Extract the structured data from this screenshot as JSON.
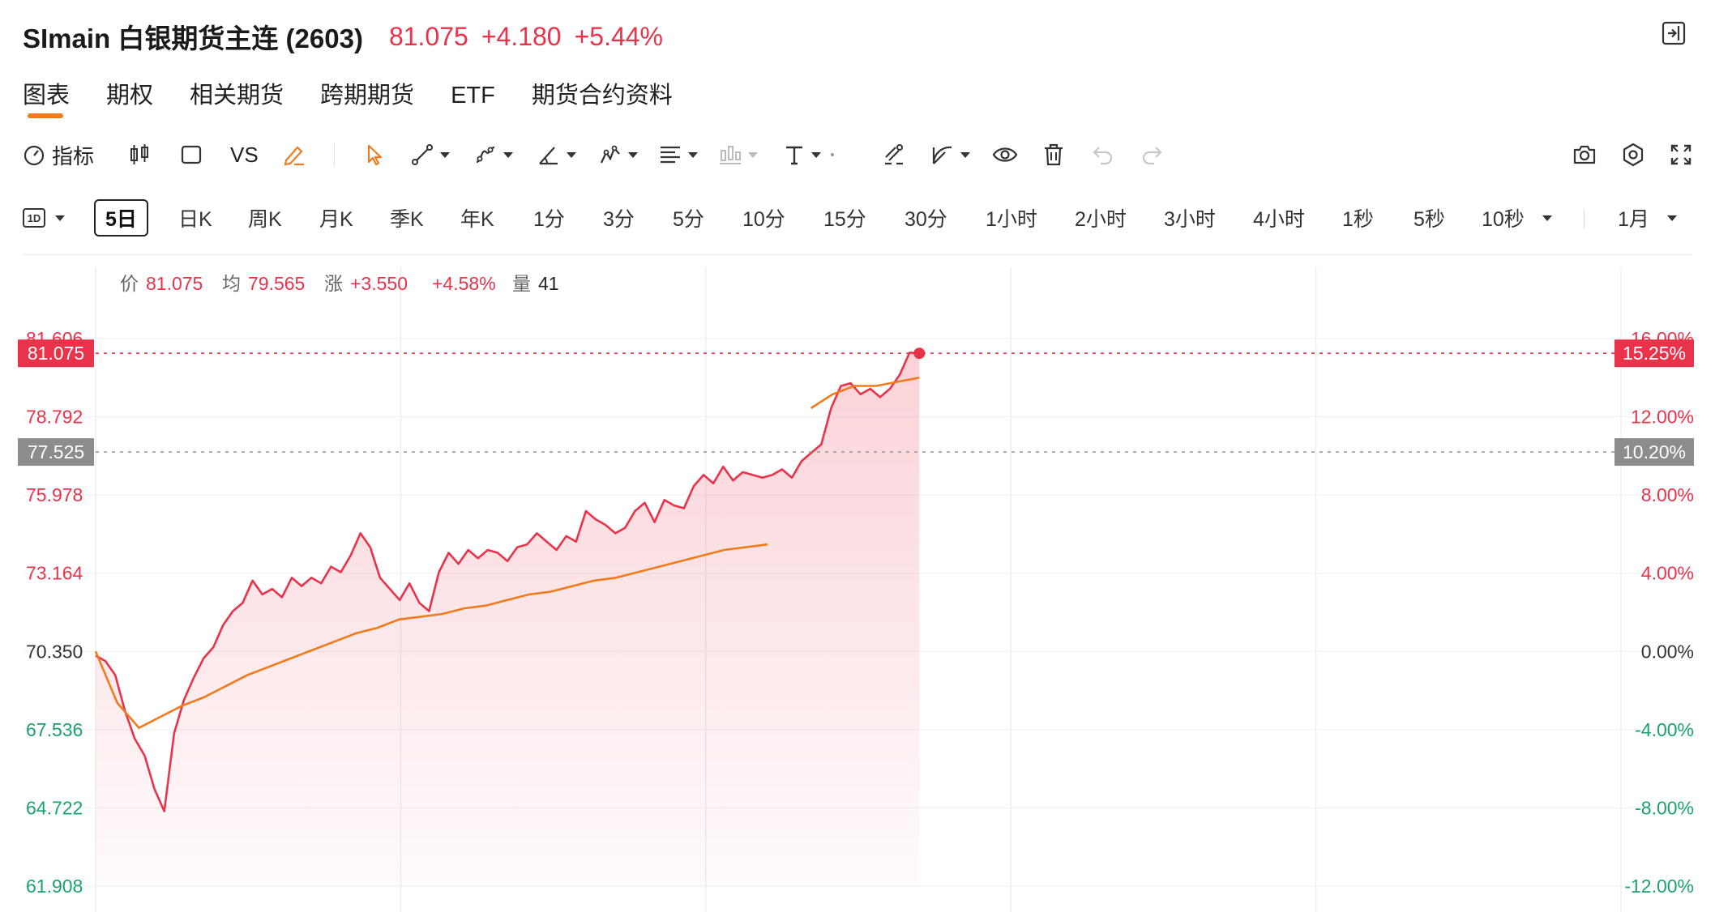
{
  "header": {
    "title": "SImain 白银期货主连 (2603)",
    "price": "81.075",
    "change": "+4.180",
    "change_pct": "+5.44%",
    "exit_icon": "exit-panel-icon"
  },
  "tabs": [
    "图表",
    "期权",
    "相关期货",
    "跨期期货",
    "ETF",
    "期货合约资料"
  ],
  "active_tab": "图表",
  "toolbar": {
    "indicator_label": "指标",
    "vs_label": "VS",
    "icons": [
      "gauge-icon",
      "candlestick-icon",
      "square-icon",
      "pencil-icon",
      "cursor-icon",
      "line-tool-icon",
      "curve-tool-icon",
      "angle-tool-icon",
      "pattern-tool-icon",
      "fib-tool-icon",
      "bars-tool-icon",
      "text-tool-icon",
      "magnet-icon",
      "measure-icon",
      "eye-icon",
      "trash-icon",
      "undo-icon",
      "redo-icon",
      "camera-icon",
      "settings-icon",
      "fullscreen-icon"
    ]
  },
  "periods": {
    "type_label": "1D",
    "items": [
      "5日",
      "日K",
      "周K",
      "月K",
      "季K",
      "年K",
      "1分",
      "3分",
      "5分",
      "10分",
      "15分",
      "30分",
      "1小时",
      "2小时",
      "3小时",
      "4小时",
      "1秒",
      "5秒",
      "10秒"
    ],
    "active": "5日",
    "range_label": "1月"
  },
  "info_bar": {
    "price_label": "价",
    "price": "81.075",
    "avg_label": "均",
    "avg": "79.565",
    "chg_label": "涨",
    "chg": "+3.550",
    "pct": "+4.58%",
    "vol_label": "量",
    "vol": "41"
  },
  "colors": {
    "up": "#e8334a",
    "down": "#1aa36c",
    "neutral": "#333333",
    "avg_line": "#f07b1c",
    "price_tag": "#e8334a",
    "ref_tag": "#8c8c8c"
  },
  "chart_data": {
    "type": "line",
    "y_ticks_left": [
      "81.606",
      "78.792",
      "75.978",
      "73.164",
      "70.350",
      "67.536",
      "64.722",
      "61.908"
    ],
    "y_ticks_right": [
      "16.00%",
      "12.00%",
      "8.00%",
      "4.00%",
      "0.00%",
      "-4.00%",
      "-8.00%",
      "-12.00%"
    ],
    "ylim": [
      61.908,
      81.606
    ],
    "base_price": 70.35,
    "current_price_tag": "81.075",
    "current_pct_tag": "15.25%",
    "ref_price_tag": "77.525",
    "ref_pct_tag": "10.20%",
    "day_count": 5,
    "series": [
      {
        "values": [
          70.2,
          70.0,
          69.5,
          68.2,
          67.2,
          66.6,
          65.4,
          64.6,
          67.4,
          68.6,
          69.4,
          70.1,
          70.5,
          71.3,
          71.8,
          72.1,
          72.9,
          72.4,
          72.6,
          72.3,
          73.0,
          72.7,
          73.0,
          72.8,
          73.4,
          73.2,
          73.8,
          74.6,
          74.1,
          73.0,
          72.6,
          72.2,
          72.8,
          72.1,
          71.8,
          73.2,
          73.9,
          73.5,
          74.0,
          73.7,
          74.0,
          73.9,
          73.6,
          74.1,
          74.2,
          74.6,
          74.3,
          74.0,
          74.5,
          74.3,
          75.4,
          75.1,
          74.9,
          74.6,
          74.8,
          75.4,
          75.7,
          75.0,
          75.8,
          75.6,
          75.5,
          76.3,
          76.7,
          76.4,
          77.0,
          76.5,
          76.8,
          76.7,
          76.6,
          76.7,
          76.9,
          76.6,
          77.2,
          77.5,
          77.8,
          79.1,
          79.9,
          80.0,
          79.6,
          79.8,
          79.5,
          79.8,
          80.3,
          81.1,
          81.075
        ]
      },
      {
        "name": "均",
        "values": [
          70.35,
          68.5,
          67.6,
          68.0,
          68.4,
          68.7,
          69.1,
          69.5,
          69.8,
          70.1,
          70.4,
          70.7,
          71.0,
          71.2,
          71.5,
          71.6,
          71.7,
          71.9,
          72.0,
          72.2,
          72.4,
          72.5,
          72.7,
          72.9,
          73.0,
          73.2,
          73.4,
          73.6,
          73.8,
          74.0,
          74.1,
          74.2,
          null,
          79.1,
          79.6,
          79.9,
          79.9,
          80.05,
          80.2
        ]
      }
    ]
  }
}
